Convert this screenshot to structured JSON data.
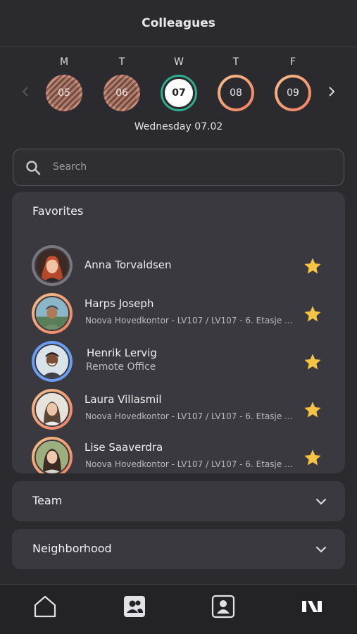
{
  "header": {
    "title": "Colleagues"
  },
  "week": {
    "prev_icon": "chevron-left-icon",
    "next_icon": "chevron-right-icon",
    "days": [
      {
        "letter": "M",
        "number": "05",
        "state": "past"
      },
      {
        "letter": "T",
        "number": "06",
        "state": "past"
      },
      {
        "letter": "W",
        "number": "07",
        "state": "current"
      },
      {
        "letter": "T",
        "number": "08",
        "state": "future"
      },
      {
        "letter": "F",
        "number": "09",
        "state": "future"
      }
    ],
    "selected_label": "Wednesday 07.02"
  },
  "search": {
    "placeholder": "Search",
    "value": "",
    "icon": "search-icon"
  },
  "favorites": {
    "title": "Favorites",
    "people": [
      {
        "name": "Anna Torvaldsen",
        "location": "",
        "ring": "grey",
        "starred": true
      },
      {
        "name": "Harps Joseph",
        "location": "Noova Hovedkontor - LV107 / LV107 - 6. Etasje ...",
        "ring": "orange",
        "starred": true
      },
      {
        "name": "Henrik Lervig",
        "location": "Remote Office",
        "ring": "blue",
        "starred": true
      },
      {
        "name": "Laura Villasmil",
        "location": "Noova Hovedkontor - LV107 / LV107 - 6. Etasje ...",
        "ring": "orange",
        "starred": true
      },
      {
        "name": "Lise Saaverdra",
        "location": "Noova Hovedkontor - LV107 / LV107 - 6. Etasje ...",
        "ring": "orange",
        "starred": true
      }
    ]
  },
  "sections": {
    "team": "Team",
    "neighborhood": "Neighborhood"
  },
  "bottom_nav": [
    "home-icon",
    "colleagues-icon",
    "profile-icon",
    "noova-logo-icon"
  ],
  "colors": {
    "background": "#2b2b2f",
    "card": "#39393f",
    "today_ring": "#2fae8f",
    "star": "#f6c343",
    "presence_blue": "#6a9ef2",
    "presence_orange": "#f07d62"
  }
}
